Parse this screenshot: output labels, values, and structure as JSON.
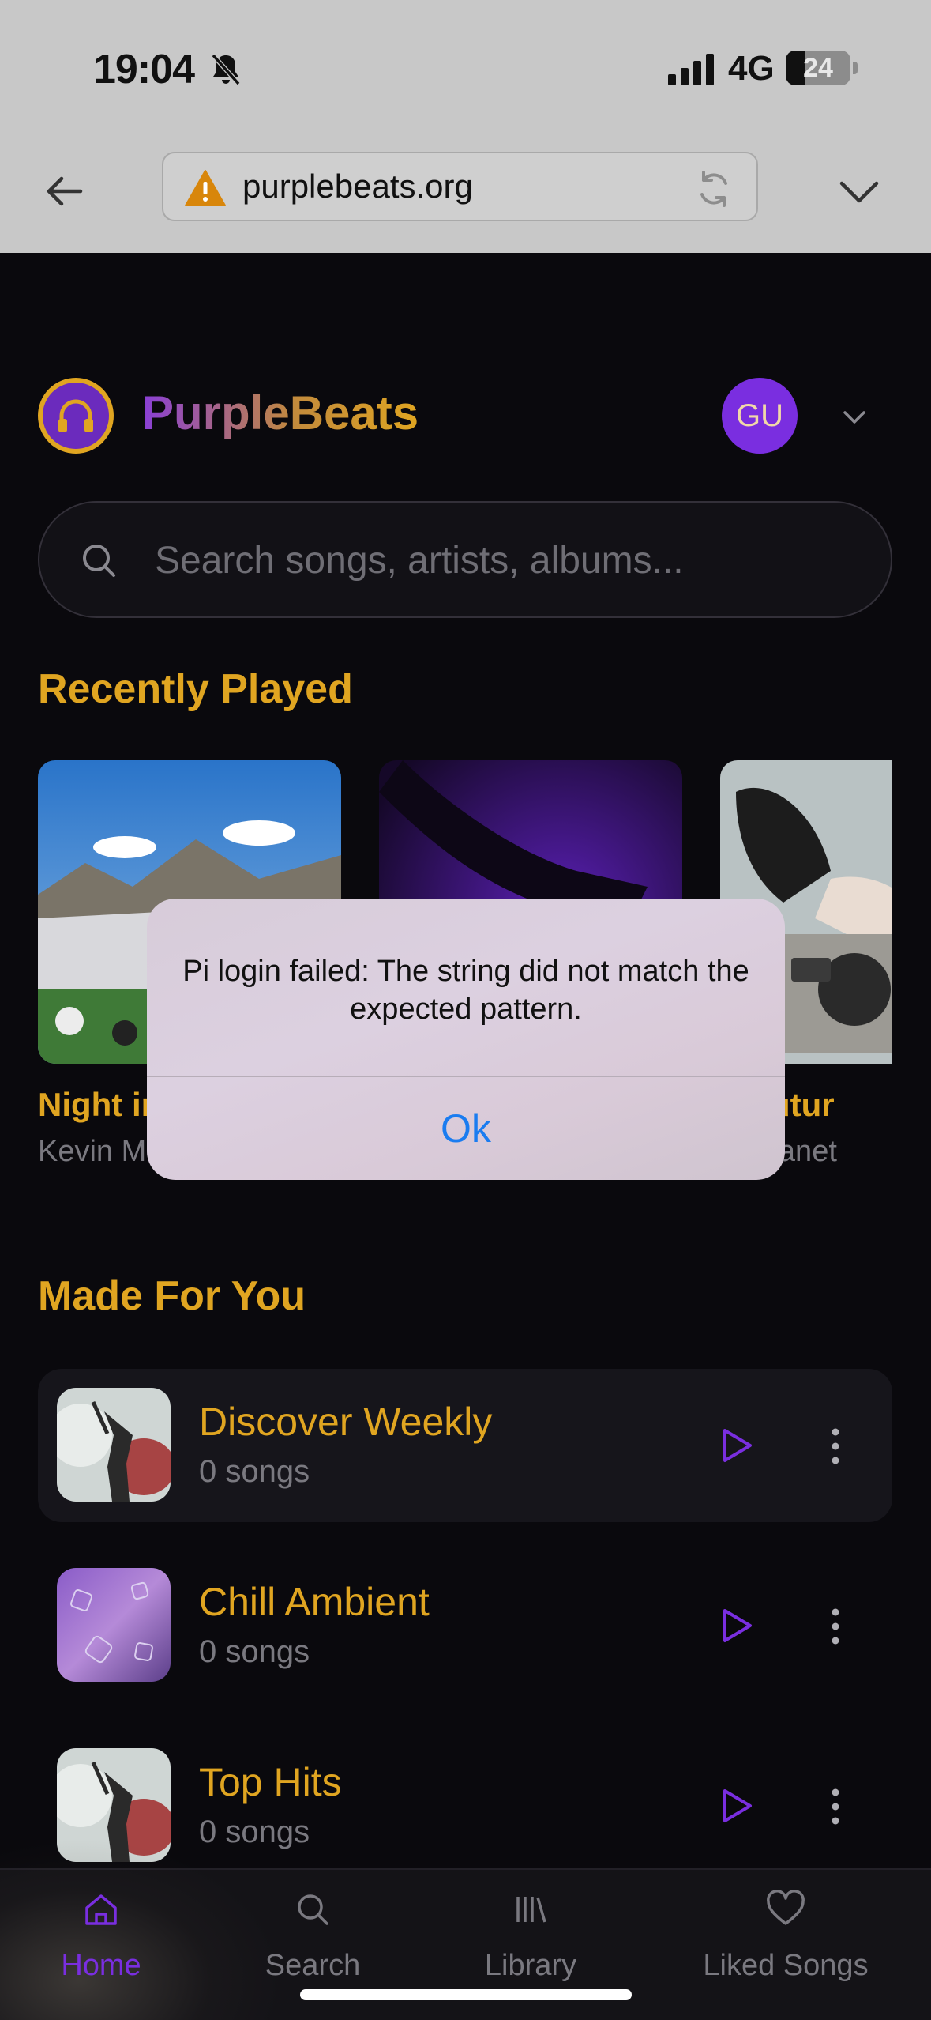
{
  "status_bar": {
    "time": "19:04",
    "network": "4G",
    "battery": "24"
  },
  "browser": {
    "url": "purplebeats.org"
  },
  "header": {
    "brand": "PurpleBeats",
    "avatar_initials": "GU"
  },
  "search": {
    "placeholder": "Search songs, artists, albums..."
  },
  "recently_played": {
    "title": "Recently Played",
    "items": [
      {
        "title": "Night in",
        "artist": "Kevin Mi"
      },
      {
        "title": "",
        "artist": ""
      },
      {
        "title": "o Futur",
        "artist": "le Planet"
      }
    ]
  },
  "made_for_you": {
    "title": "Made For You",
    "items": [
      {
        "name": "Discover Weekly",
        "count": "0 songs"
      },
      {
        "name": "Chill Ambient",
        "count": "0 songs"
      },
      {
        "name": "Top Hits",
        "count": "0 songs"
      }
    ]
  },
  "bottom_nav": {
    "items": [
      {
        "label": "Home",
        "icon": "home-icon"
      },
      {
        "label": "Search",
        "icon": "search-icon"
      },
      {
        "label": "Library",
        "icon": "library-icon"
      },
      {
        "label": "Liked Songs",
        "icon": "heart-icon"
      }
    ]
  },
  "alert": {
    "message": "Pi login failed: The string did not match the expected pattern.",
    "button": "Ok"
  },
  "colors": {
    "accent": "#e0a521",
    "brand_purple": "#7a2ee0",
    "background": "#0a090d",
    "alert_link": "#1a7cf0"
  }
}
